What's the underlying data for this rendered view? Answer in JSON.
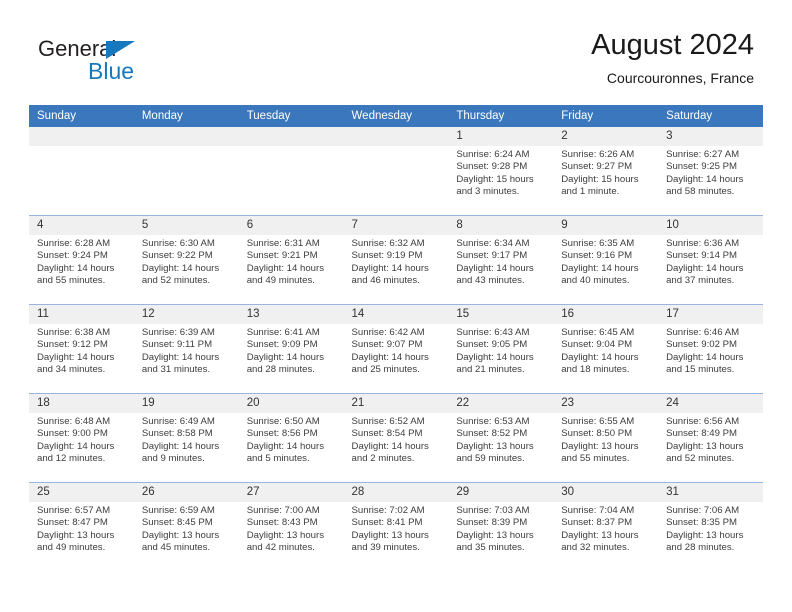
{
  "brand": {
    "name_part1": "General",
    "name_part2": "Blue",
    "accent_color": "#1878be"
  },
  "header": {
    "title": "August 2024",
    "subtitle": "Courcouronnes, France"
  },
  "theme": {
    "header_row_bg": "#3a77bd",
    "header_row_text": "#ffffff",
    "daynum_bg": "#f0f0f0",
    "row_divider": "#96b7dd"
  },
  "weekday_headers": [
    "Sunday",
    "Monday",
    "Tuesday",
    "Wednesday",
    "Thursday",
    "Friday",
    "Saturday"
  ],
  "weeks": [
    [
      {
        "day": "",
        "empty": true,
        "sunrise": "",
        "sunset": "",
        "daylight": ""
      },
      {
        "day": "",
        "empty": true,
        "sunrise": "",
        "sunset": "",
        "daylight": ""
      },
      {
        "day": "",
        "empty": true,
        "sunrise": "",
        "sunset": "",
        "daylight": ""
      },
      {
        "day": "",
        "empty": true,
        "sunrise": "",
        "sunset": "",
        "daylight": ""
      },
      {
        "day": "1",
        "empty": false,
        "sunrise": "Sunrise: 6:24 AM",
        "sunset": "Sunset: 9:28 PM",
        "daylight": "Daylight: 15 hours and 3 minutes."
      },
      {
        "day": "2",
        "empty": false,
        "sunrise": "Sunrise: 6:26 AM",
        "sunset": "Sunset: 9:27 PM",
        "daylight": "Daylight: 15 hours and 1 minute."
      },
      {
        "day": "3",
        "empty": false,
        "sunrise": "Sunrise: 6:27 AM",
        "sunset": "Sunset: 9:25 PM",
        "daylight": "Daylight: 14 hours and 58 minutes."
      }
    ],
    [
      {
        "day": "4",
        "empty": false,
        "sunrise": "Sunrise: 6:28 AM",
        "sunset": "Sunset: 9:24 PM",
        "daylight": "Daylight: 14 hours and 55 minutes."
      },
      {
        "day": "5",
        "empty": false,
        "sunrise": "Sunrise: 6:30 AM",
        "sunset": "Sunset: 9:22 PM",
        "daylight": "Daylight: 14 hours and 52 minutes."
      },
      {
        "day": "6",
        "empty": false,
        "sunrise": "Sunrise: 6:31 AM",
        "sunset": "Sunset: 9:21 PM",
        "daylight": "Daylight: 14 hours and 49 minutes."
      },
      {
        "day": "7",
        "empty": false,
        "sunrise": "Sunrise: 6:32 AM",
        "sunset": "Sunset: 9:19 PM",
        "daylight": "Daylight: 14 hours and 46 minutes."
      },
      {
        "day": "8",
        "empty": false,
        "sunrise": "Sunrise: 6:34 AM",
        "sunset": "Sunset: 9:17 PM",
        "daylight": "Daylight: 14 hours and 43 minutes."
      },
      {
        "day": "9",
        "empty": false,
        "sunrise": "Sunrise: 6:35 AM",
        "sunset": "Sunset: 9:16 PM",
        "daylight": "Daylight: 14 hours and 40 minutes."
      },
      {
        "day": "10",
        "empty": false,
        "sunrise": "Sunrise: 6:36 AM",
        "sunset": "Sunset: 9:14 PM",
        "daylight": "Daylight: 14 hours and 37 minutes."
      }
    ],
    [
      {
        "day": "11",
        "empty": false,
        "sunrise": "Sunrise: 6:38 AM",
        "sunset": "Sunset: 9:12 PM",
        "daylight": "Daylight: 14 hours and 34 minutes."
      },
      {
        "day": "12",
        "empty": false,
        "sunrise": "Sunrise: 6:39 AM",
        "sunset": "Sunset: 9:11 PM",
        "daylight": "Daylight: 14 hours and 31 minutes."
      },
      {
        "day": "13",
        "empty": false,
        "sunrise": "Sunrise: 6:41 AM",
        "sunset": "Sunset: 9:09 PM",
        "daylight": "Daylight: 14 hours and 28 minutes."
      },
      {
        "day": "14",
        "empty": false,
        "sunrise": "Sunrise: 6:42 AM",
        "sunset": "Sunset: 9:07 PM",
        "daylight": "Daylight: 14 hours and 25 minutes."
      },
      {
        "day": "15",
        "empty": false,
        "sunrise": "Sunrise: 6:43 AM",
        "sunset": "Sunset: 9:05 PM",
        "daylight": "Daylight: 14 hours and 21 minutes."
      },
      {
        "day": "16",
        "empty": false,
        "sunrise": "Sunrise: 6:45 AM",
        "sunset": "Sunset: 9:04 PM",
        "daylight": "Daylight: 14 hours and 18 minutes."
      },
      {
        "day": "17",
        "empty": false,
        "sunrise": "Sunrise: 6:46 AM",
        "sunset": "Sunset: 9:02 PM",
        "daylight": "Daylight: 14 hours and 15 minutes."
      }
    ],
    [
      {
        "day": "18",
        "empty": false,
        "sunrise": "Sunrise: 6:48 AM",
        "sunset": "Sunset: 9:00 PM",
        "daylight": "Daylight: 14 hours and 12 minutes."
      },
      {
        "day": "19",
        "empty": false,
        "sunrise": "Sunrise: 6:49 AM",
        "sunset": "Sunset: 8:58 PM",
        "daylight": "Daylight: 14 hours and 9 minutes."
      },
      {
        "day": "20",
        "empty": false,
        "sunrise": "Sunrise: 6:50 AM",
        "sunset": "Sunset: 8:56 PM",
        "daylight": "Daylight: 14 hours and 5 minutes."
      },
      {
        "day": "21",
        "empty": false,
        "sunrise": "Sunrise: 6:52 AM",
        "sunset": "Sunset: 8:54 PM",
        "daylight": "Daylight: 14 hours and 2 minutes."
      },
      {
        "day": "22",
        "empty": false,
        "sunrise": "Sunrise: 6:53 AM",
        "sunset": "Sunset: 8:52 PM",
        "daylight": "Daylight: 13 hours and 59 minutes."
      },
      {
        "day": "23",
        "empty": false,
        "sunrise": "Sunrise: 6:55 AM",
        "sunset": "Sunset: 8:50 PM",
        "daylight": "Daylight: 13 hours and 55 minutes."
      },
      {
        "day": "24",
        "empty": false,
        "sunrise": "Sunrise: 6:56 AM",
        "sunset": "Sunset: 8:49 PM",
        "daylight": "Daylight: 13 hours and 52 minutes."
      }
    ],
    [
      {
        "day": "25",
        "empty": false,
        "sunrise": "Sunrise: 6:57 AM",
        "sunset": "Sunset: 8:47 PM",
        "daylight": "Daylight: 13 hours and 49 minutes."
      },
      {
        "day": "26",
        "empty": false,
        "sunrise": "Sunrise: 6:59 AM",
        "sunset": "Sunset: 8:45 PM",
        "daylight": "Daylight: 13 hours and 45 minutes."
      },
      {
        "day": "27",
        "empty": false,
        "sunrise": "Sunrise: 7:00 AM",
        "sunset": "Sunset: 8:43 PM",
        "daylight": "Daylight: 13 hours and 42 minutes."
      },
      {
        "day": "28",
        "empty": false,
        "sunrise": "Sunrise: 7:02 AM",
        "sunset": "Sunset: 8:41 PM",
        "daylight": "Daylight: 13 hours and 39 minutes."
      },
      {
        "day": "29",
        "empty": false,
        "sunrise": "Sunrise: 7:03 AM",
        "sunset": "Sunset: 8:39 PM",
        "daylight": "Daylight: 13 hours and 35 minutes."
      },
      {
        "day": "30",
        "empty": false,
        "sunrise": "Sunrise: 7:04 AM",
        "sunset": "Sunset: 8:37 PM",
        "daylight": "Daylight: 13 hours and 32 minutes."
      },
      {
        "day": "31",
        "empty": false,
        "sunrise": "Sunrise: 7:06 AM",
        "sunset": "Sunset: 8:35 PM",
        "daylight": "Daylight: 13 hours and 28 minutes."
      }
    ]
  ]
}
